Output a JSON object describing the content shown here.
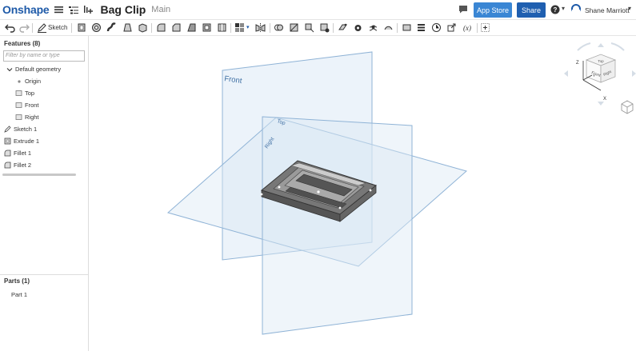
{
  "app": {
    "logo": "Onshape"
  },
  "document": {
    "title": "Bag Clip",
    "branch": "Main"
  },
  "header": {
    "app_store_label": "App Store",
    "share_label": "Share",
    "help_caret": "▾",
    "user_name": "Shane Marriott",
    "user_caret": "▾"
  },
  "toolbar": {
    "sketch_label": "Sketch"
  },
  "features": {
    "title": "Features (8)",
    "filter_placeholder": "Filter by name or type",
    "default_geometry_label": "Default geometry",
    "items": [
      {
        "label": "Origin",
        "icon": "origin-point-icon"
      },
      {
        "label": "Top",
        "icon": "plane-icon"
      },
      {
        "label": "Front",
        "icon": "plane-icon"
      },
      {
        "label": "Right",
        "icon": "plane-icon"
      },
      {
        "label": "Sketch 1",
        "icon": "sketch-icon"
      },
      {
        "label": "Extrude 1",
        "icon": "extrude-icon"
      },
      {
        "label": "Fillet 1",
        "icon": "fillet-icon"
      },
      {
        "label": "Fillet 2",
        "icon": "fillet-icon"
      }
    ]
  },
  "parts": {
    "title": "Parts (1)",
    "items": [
      {
        "label": "Part 1"
      }
    ]
  },
  "viewport": {
    "plane_labels": {
      "front": "Front",
      "top": "Top",
      "right": "Right"
    },
    "view_cube": {
      "top": "Top",
      "front": "Front",
      "right": "Right",
      "axis_x": "X",
      "axis_y": "Y",
      "axis_z": "Z"
    }
  },
  "colors": {
    "brand": "#1e5aa8",
    "app_store_bg": "#3a86d4",
    "share_bg": "#1f5fb0",
    "plane_fill": "#dce9f5",
    "plane_stroke": "#8fb3d6"
  }
}
